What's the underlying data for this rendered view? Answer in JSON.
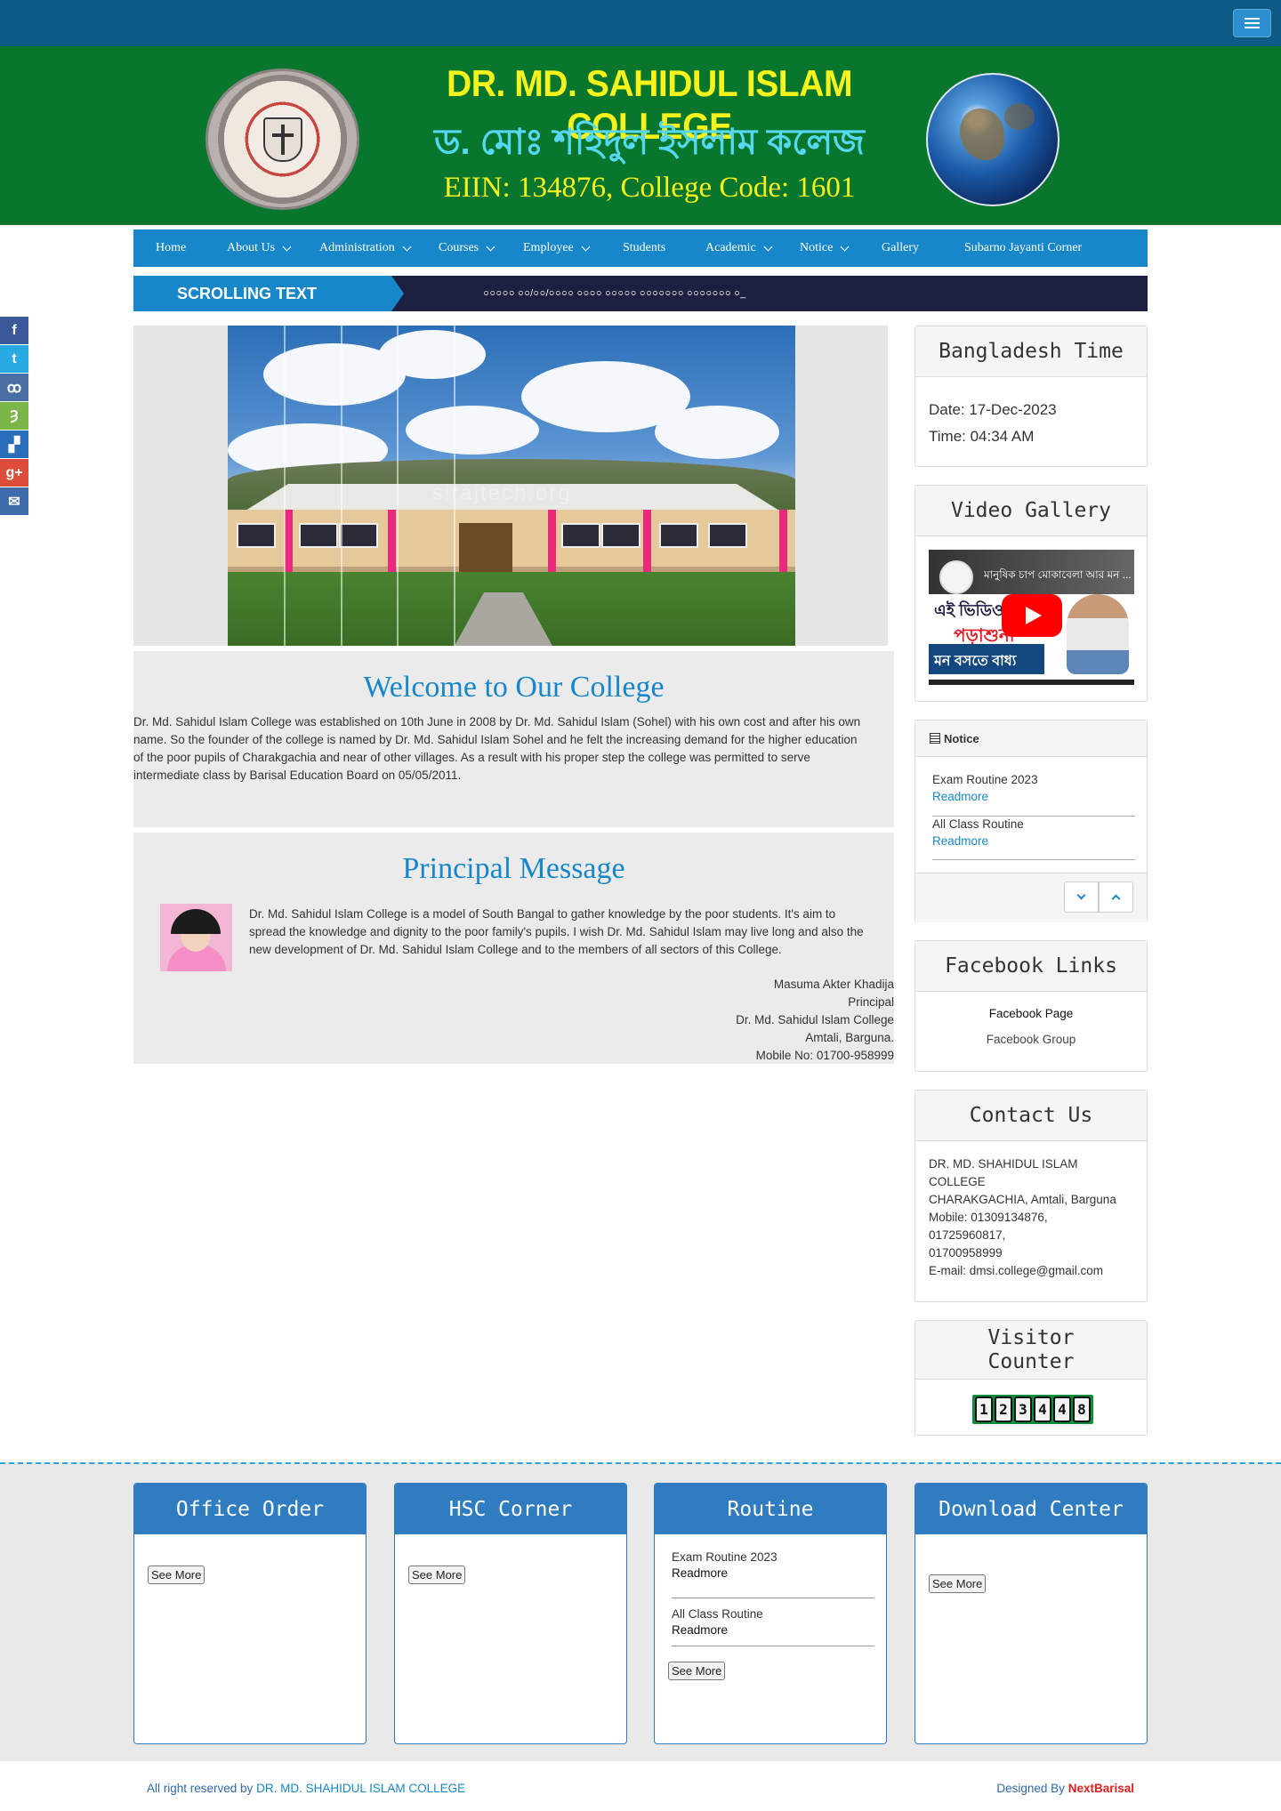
{
  "header": {
    "college_name_en": "DR. MD. SAHIDUL ISLAM COLLEGE",
    "college_name_bn": "ড. মোঃ শহিদুল ইসলাম কলেজ",
    "eiin_line": "EIIN: 134876, College Code: 1601"
  },
  "nav": {
    "items": [
      {
        "label": "Home",
        "dropdown": false
      },
      {
        "label": "About Us",
        "dropdown": true
      },
      {
        "label": "Administration",
        "dropdown": true
      },
      {
        "label": "Courses",
        "dropdown": true
      },
      {
        "label": "Employee",
        "dropdown": true
      },
      {
        "label": "Students",
        "dropdown": false
      },
      {
        "label": "Academic",
        "dropdown": true
      },
      {
        "label": "Notice",
        "dropdown": true
      },
      {
        "label": "Gallery",
        "dropdown": false
      },
      {
        "label": "Subarno Jayanti Corner",
        "dropdown": false
      }
    ]
  },
  "scrolling": {
    "label": "SCROLLING TEXT",
    "text": "০০০০০ ০০/০০/০০০০ ০০০০ ০০০০০ ০০০০০০০ ০০০০০০০ ০_"
  },
  "social": [
    {
      "icon": "facebook-icon",
      "glyph": "f",
      "color": "#3b5998"
    },
    {
      "icon": "twitter-icon",
      "glyph": "t",
      "color": "#29a9e1"
    },
    {
      "icon": "myspace-icon",
      "glyph": "ꝏ",
      "color": "#4a6fa5"
    },
    {
      "icon": "delicious-icon",
      "glyph": "Ȝ",
      "color": "#7ab648"
    },
    {
      "icon": "stumble-icon",
      "glyph": "▞",
      "color": "#2a6ebb"
    },
    {
      "icon": "google-plus-icon",
      "glyph": "g+",
      "color": "#dd4b39"
    },
    {
      "icon": "email-icon",
      "glyph": "✉",
      "color": "#3d6aa8"
    }
  ],
  "slider": {
    "watermark": "sirajtech.org"
  },
  "welcome": {
    "title": "Welcome to Our College",
    "lines": [
      "Dr. Md. Sahidul Islam College was established on 10th June in 2008 by Dr. Md. Sahidul Islam (Sohel) with his own cost and after his own",
      "name. So the founder of the college is named by Dr. Md. Sahidul Islam Sohel and he felt the increasing demand for the higher education",
      "of the poor pupils of Charakgachia and near of other villages. As a result with his proper step the college was permitted to serve",
      "intermediate class by Barisal Education Board on 05/05/2011."
    ]
  },
  "principal": {
    "title": "Principal Message",
    "lines": [
      "Dr. Md. Sahidul Islam College is a model of South Bangal to gather knowledge by the poor students. It's aim to",
      "spread the knowledge and dignity to the poor family's pupils. I wish Dr. Md. Sahidul Islam may live long and also the",
      "new development of Dr. Md. Sahidul Islam College and to the members of all sectors of this College."
    ],
    "signature": [
      "Masuma Akter Khadija",
      "Principal",
      "Dr. Md. Sahidul Islam College",
      "Amtali, Barguna.",
      "Mobile No: 01700-958999"
    ]
  },
  "sidebar": {
    "time": {
      "title": "Bangladesh Time",
      "date": "Date: 17-Dec-2023",
      "time": "Time: 04:34 AM"
    },
    "video": {
      "title": "Video Gallery",
      "thumb_title": "মানুষিক চাপ মোকাবেলা আর মন ...",
      "bn_line1": "এই ভিডিও",
      "bn_line2": "পড়াশুনা",
      "bn_line3": "মন বসতে বাধ্য"
    },
    "notice": {
      "title": "Notice",
      "items": [
        {
          "title": "Exam Routine 2023",
          "link": "Readmore"
        },
        {
          "title": "All Class Routine",
          "link": "Readmore"
        }
      ]
    },
    "facebook": {
      "title": "Facebook Links",
      "page": "Facebook Page",
      "group": "Facebook Group"
    },
    "contact": {
      "title": "Contact Us",
      "lines": [
        "DR. MD. SHAHIDUL ISLAM",
        "COLLEGE",
        "CHARAKGACHIA, Amtali, Barguna",
        "Mobile: 01309134876,",
        "01725960817,",
        "01700958999",
        "E-mail: dmsi.college@gmail.com"
      ]
    },
    "visitor": {
      "title_line1": "Visitor",
      "title_line2": "Counter",
      "digits": [
        "1",
        "2",
        "3",
        "4",
        "4",
        "8"
      ]
    }
  },
  "bottom": {
    "office_order": {
      "title": "Office Order",
      "button": "See More"
    },
    "hsc_corner": {
      "title": "HSC Corner",
      "button": "See More"
    },
    "routine": {
      "title": "Routine",
      "items": [
        {
          "title": "Exam Routine 2023",
          "link": "Readmore"
        },
        {
          "title": "All Class Routine",
          "link": "Readmore"
        }
      ],
      "button": "See More"
    },
    "download": {
      "title": "Download Center",
      "button": "See More"
    }
  },
  "footer": {
    "rights_prefix": "All right reserved by",
    "rights_name": "DR. MD. SHAHIDUL ISLAM COLLEGE",
    "designed_prefix": "Designed By",
    "designer": "NextBarisal"
  },
  "colors": {
    "topbar": "#0d5a85",
    "banner": "#08762d",
    "nav": "#1787c9",
    "accent_blue": "#2f7cc0",
    "designer_red": "#e0201c"
  }
}
